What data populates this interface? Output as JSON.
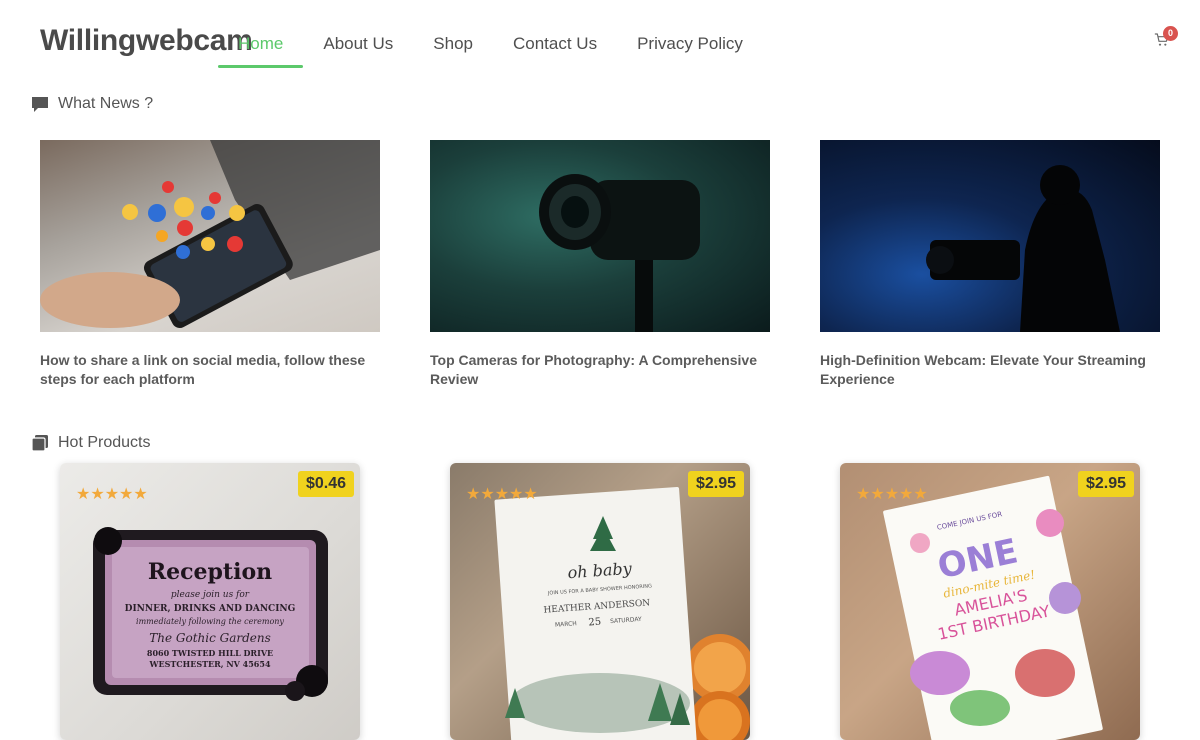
{
  "header": {
    "logo": "Willingwebcam",
    "nav": [
      "Home",
      "About Us",
      "Shop",
      "Contact Us",
      "Privacy Policy"
    ],
    "active_nav": "Home",
    "cart_count": "0"
  },
  "sections": {
    "news_title": "What News ?",
    "hot_title": "Hot Products"
  },
  "news": [
    {
      "title": "How to share a link on social media, follow these steps for each platform"
    },
    {
      "title": "Top Cameras for Photography: A Comprehensive Review"
    },
    {
      "title": "High-Definition Webcam: Elevate Your Streaming Experience"
    }
  ],
  "products": [
    {
      "price": "$0.46",
      "rating": 5,
      "card_lines": [
        "Reception",
        "please join us for",
        "DINNER, DRINKS AND DANCING",
        "immediately following the ceremony",
        "The Gothic Gardens",
        "8060 TWISTED HILL DRIVE",
        "WESTCHESTER, NV 45654"
      ]
    },
    {
      "price": "$2.95",
      "rating": 5,
      "card_lines": [
        "oh baby",
        "JOIN US FOR A BABY SHOWER HONORING",
        "HEATHER ANDERSON",
        "MARCH",
        "25",
        "SATURDAY"
      ]
    },
    {
      "price": "$2.95",
      "rating": 5,
      "card_lines": [
        "COME JOIN US FOR",
        "ONE",
        "dino-mite time!",
        "AMELIA'S",
        "1ST BIRTHDAY"
      ]
    }
  ],
  "colors": {
    "accent": "#5cc96b",
    "price_bg": "#f0d21e",
    "star": "#f2a93b",
    "badge": "#d9534f"
  }
}
